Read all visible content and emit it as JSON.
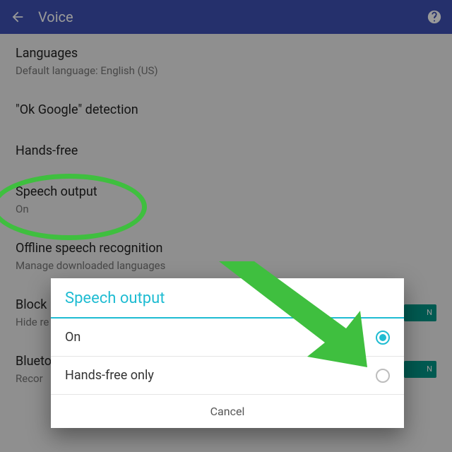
{
  "appbar": {
    "title": "Voice"
  },
  "settings": {
    "languages": {
      "title": "Languages",
      "subtitle": "Default language: English (US)"
    },
    "ok_google": {
      "title": "\"Ok Google\" detection"
    },
    "hands_free": {
      "title": "Hands-free"
    },
    "speech_output": {
      "title": "Speech output",
      "subtitle": "On"
    },
    "offline": {
      "title": "Offline speech recognition",
      "subtitle": "Manage downloaded languages"
    },
    "block": {
      "title": "Block",
      "subtitle": "Hide re",
      "switch": "N"
    },
    "bluetooth": {
      "title": "Blueto",
      "subtitle": "Recor",
      "switch": "N"
    }
  },
  "dialog": {
    "title": "Speech output",
    "options": [
      {
        "label": "On",
        "selected": true
      },
      {
        "label": "Hands-free only",
        "selected": false
      }
    ],
    "cancel": "Cancel"
  },
  "colors": {
    "accent": "#1fbcd2",
    "appbar": "#3f51b5",
    "annotation": "#3fbf3f"
  }
}
